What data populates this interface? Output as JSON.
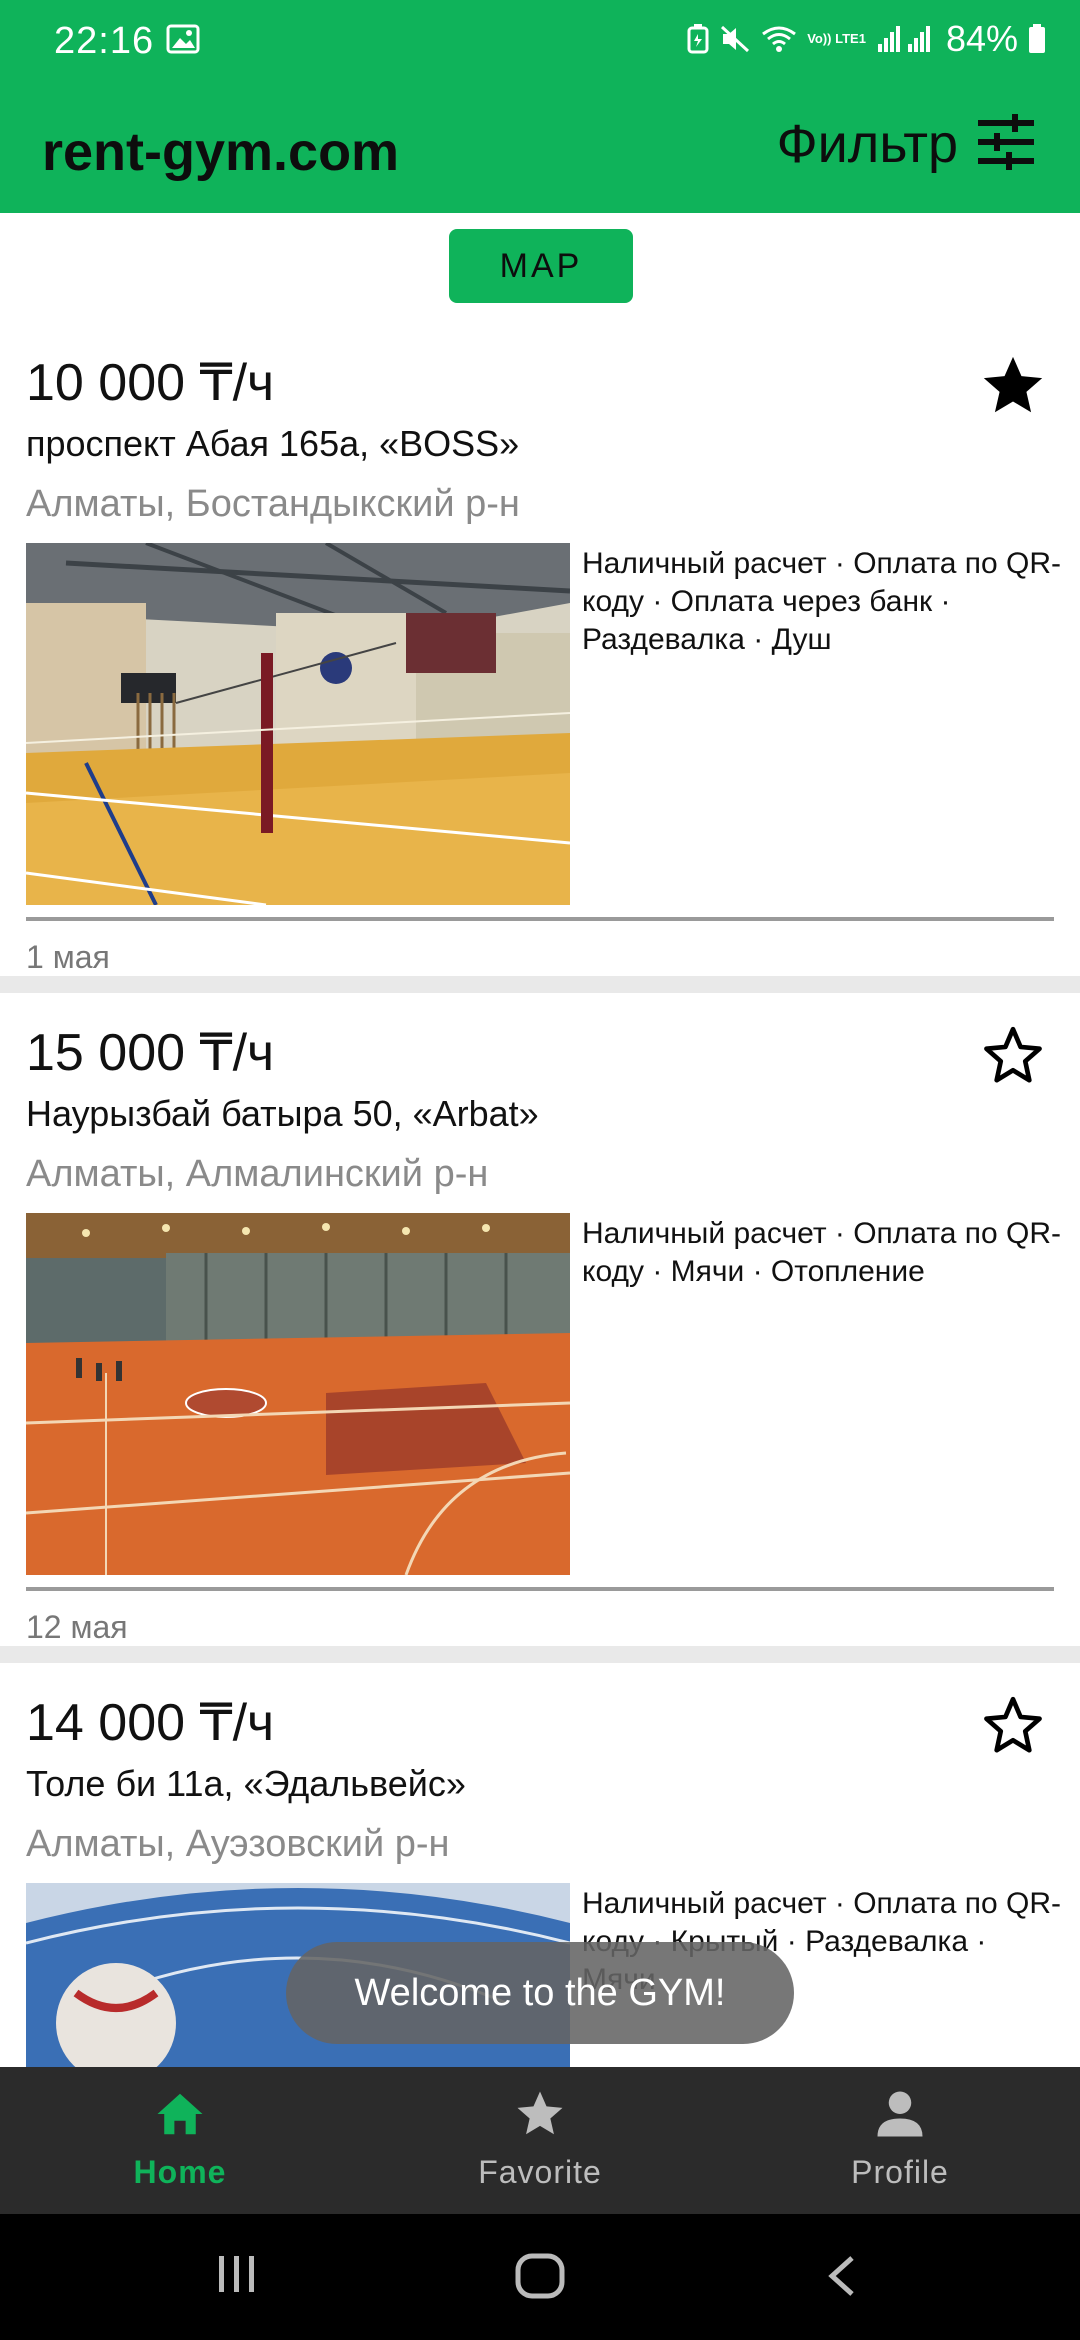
{
  "status_bar": {
    "time": "22:16",
    "battery": "84%",
    "network_label": "Vo)) LTE1"
  },
  "app_bar": {
    "title": "rent-gym.com",
    "filter_label": "Фильтр"
  },
  "map_button": {
    "label": "MAP"
  },
  "listings": [
    {
      "price": "10 000 ₸/ч",
      "address": "проспект Абая 165а, «BOSS»",
      "district": "Алматы, Бостандыкский р-н",
      "amenities": "Наличный расчет · Оплата по QR-коду · Оплата через банк · Раздевалка · Душ",
      "date": "1 мая",
      "favorite": true
    },
    {
      "price": "15 000 ₸/ч",
      "address": "Наурызбай батыра 50, «Arbat»",
      "district": "Алматы, Алмалинский р-н",
      "amenities": "Наличный расчет · Оплата по QR-коду · Мячи · Отопление",
      "date": "12 мая",
      "favorite": false
    },
    {
      "price": "14 000 ₸/ч",
      "address": "Толе би 11а, «Эдальвейс»",
      "district": "Алматы, Ауэзовский р-н",
      "amenities": "Наличный расчет · Оплата по QR-коду · Крытый · Раздевалка · Мячи",
      "date": "",
      "favorite": false
    }
  ],
  "toast": {
    "message": "Welcome to the GYM!"
  },
  "bottom_nav": {
    "items": [
      {
        "label": "Home",
        "icon": "home-icon",
        "active": true
      },
      {
        "label": "Favorite",
        "icon": "star-icon",
        "active": false
      },
      {
        "label": "Profile",
        "icon": "person-icon",
        "active": false
      }
    ]
  },
  "colors": {
    "brand_green": "#0fb35a",
    "nav_background": "#2b2b2b",
    "muted_text": "#8a8a8a"
  }
}
